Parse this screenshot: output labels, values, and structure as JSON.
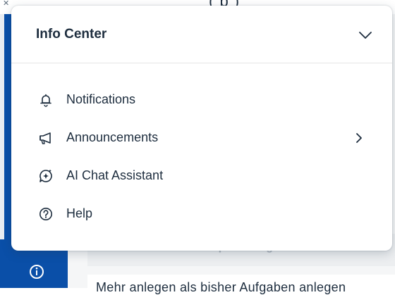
{
  "info_center": {
    "title": "Info Center",
    "items": [
      {
        "label": "Notifications",
        "icon": "bell-icon",
        "has_submenu": false
      },
      {
        "label": "Announcements",
        "icon": "megaphone-icon",
        "has_submenu": true
      },
      {
        "label": "AI Chat Assistant",
        "icon": "ai-chat-icon",
        "has_submenu": false
      },
      {
        "label": "Help",
        "icon": "help-icon",
        "has_submenu": false
      }
    ]
  },
  "background": {
    "top_text": "(       p       )",
    "card_text": "Lieferantenportal Aufgaben Emm.  Ve",
    "bottom_text": "Mehr anlegen als bisher Aufgaben anlegen"
  },
  "colors": {
    "rail": "#0a4fa8",
    "text": "#1d2d3e",
    "divider": "#e5e5e5"
  }
}
